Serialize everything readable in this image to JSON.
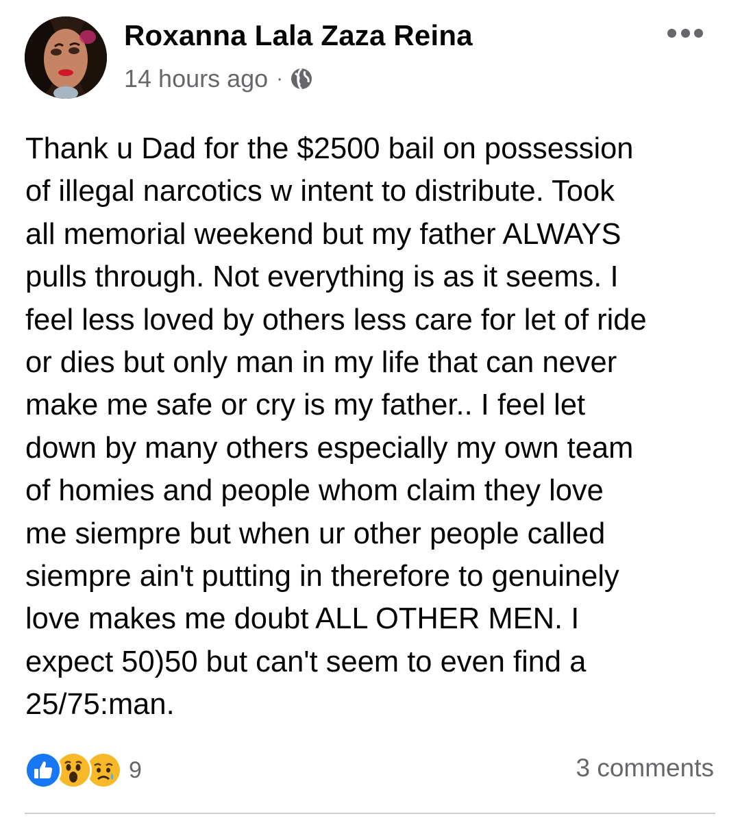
{
  "post": {
    "author_name": "Roxanna Lala Zaza Reina",
    "timestamp": "14 hours ago",
    "separator": "·",
    "audience_icon": "globe-icon",
    "menu_icon": "more-horizontal-icon",
    "text": "Thank u Dad for the $2500 bail on possession\nof illegal narcotics w intent to distribute. Took\nall memorial weekend but my father ALWAYS\npulls through. Not everything is as it seems. I\nfeel less loved by others less care for let of ride\nor dies but only man in my life that can never\nmake me safe or cry is my father.. I feel let\ndown by many others especially my own team\nof homies and people whom claim they love\nme siempre but when ur other people called\nsiempre ain't putting in therefore to genuinely\nlove makes me doubt ALL OTHER MEN. I\nexpect 50)50 but can't seem to even find a\n25/75:man."
  },
  "reactions": {
    "icons": [
      "like-icon",
      "wow-icon",
      "sad-icon"
    ],
    "count": "9"
  },
  "comments": {
    "label": "3 comments"
  },
  "colors": {
    "text_primary": "#050505",
    "text_secondary": "#65676b",
    "like_blue": "#1877f2",
    "emoji_yellow": "#f7b928",
    "divider": "#ced0d4"
  }
}
